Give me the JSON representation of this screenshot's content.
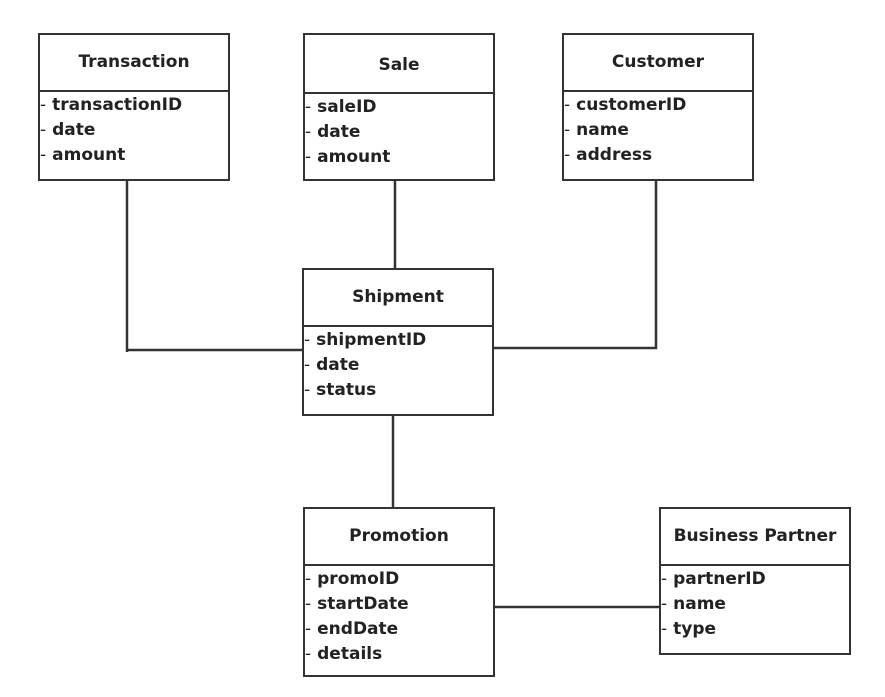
{
  "entities": {
    "transaction": {
      "title": "Transaction",
      "attributes": [
        "transactionID",
        "date",
        "amount"
      ]
    },
    "sale": {
      "title": "Sale",
      "attributes": [
        "saleID",
        "date",
        "amount"
      ]
    },
    "customer": {
      "title": "Customer",
      "attributes": [
        "customerID",
        "name",
        "address"
      ]
    },
    "shipment": {
      "title": "Shipment",
      "attributes": [
        "shipmentID",
        "date",
        "status"
      ]
    },
    "promotion": {
      "title": "Promotion",
      "attributes": [
        "promoID",
        "startDate",
        "endDate",
        "details"
      ]
    },
    "business_partner": {
      "title": "Business Partner",
      "attributes": [
        "partnerID",
        "name",
        "type"
      ]
    }
  },
  "connections": [
    [
      "transaction",
      "shipment"
    ],
    [
      "sale",
      "shipment"
    ],
    [
      "customer",
      "shipment"
    ],
    [
      "shipment",
      "promotion"
    ],
    [
      "promotion",
      "business_partner"
    ]
  ],
  "colors": {
    "line": "#333333",
    "background": "#ffffff"
  }
}
